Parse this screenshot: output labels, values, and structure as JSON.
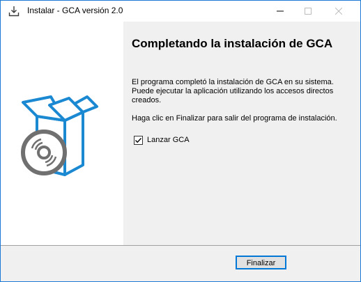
{
  "window": {
    "title": "Instalar - GCA versión 2.0",
    "accent_color": "#1c7ad6"
  },
  "icons": {
    "app": "installer-download-icon",
    "minimize": "minimize-icon",
    "maximize": "maximize-icon",
    "close": "close-icon",
    "logo": "box-with-disc-icon"
  },
  "content": {
    "heading": "Completando la instalación de GCA",
    "paragraph1": "El programa completó la instalación de GCA en su sistema. Puede ejecutar la aplicación utilizando los accesos directos creados.",
    "paragraph2": "Haga clic en Finalizar para salir del programa de instalación.",
    "launch_checkbox": {
      "label": "Lanzar GCA",
      "checked": true
    }
  },
  "footer": {
    "finish_label": "Finalizar"
  }
}
